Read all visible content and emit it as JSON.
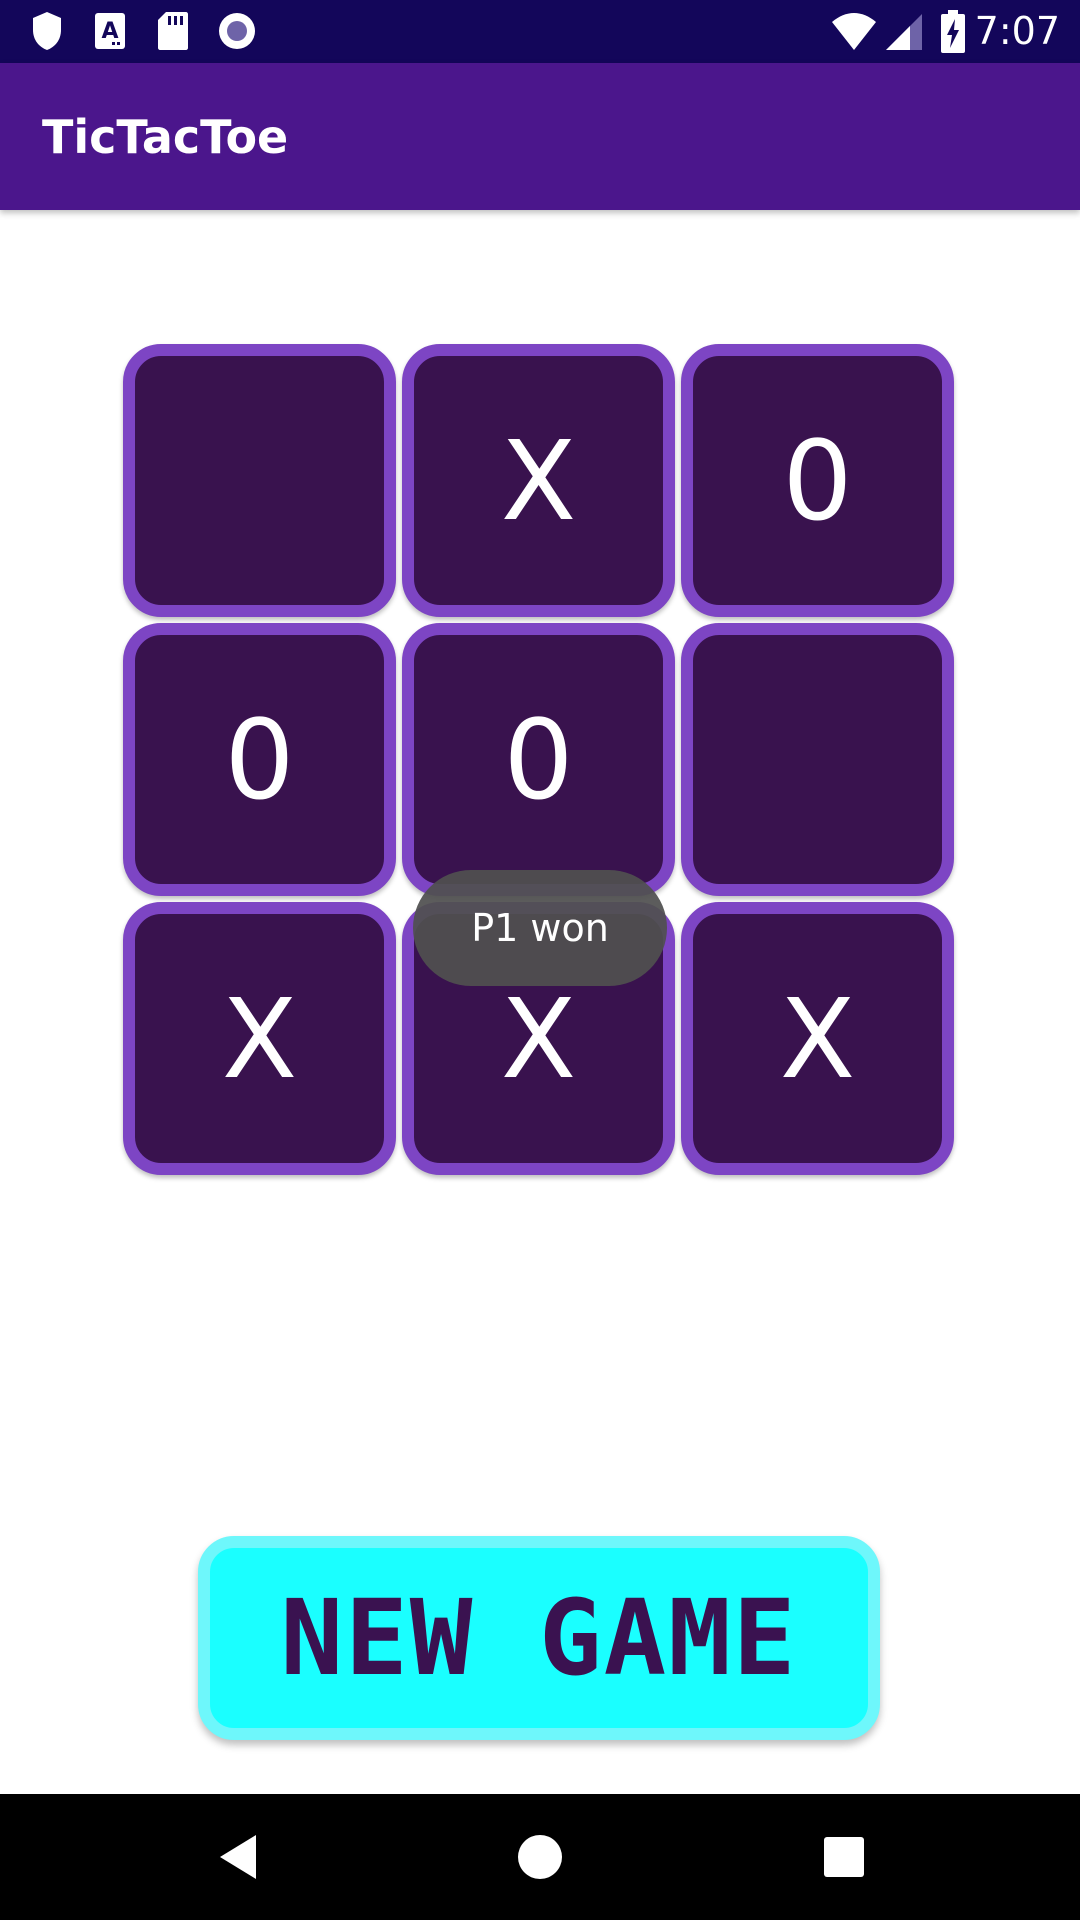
{
  "status_bar": {
    "time": "7:07",
    "left_icons": [
      "shield-icon",
      "text-a-icon",
      "sd-card-icon",
      "record-icon"
    ],
    "right_icons": [
      "wifi-icon",
      "signal-icon",
      "battery-charging-icon"
    ]
  },
  "app_bar": {
    "title": "TicTacToe"
  },
  "board": {
    "cells": [
      "",
      "X",
      "0",
      "0",
      "0",
      "",
      "X",
      "X",
      "X"
    ]
  },
  "toast": {
    "message": "P1 won"
  },
  "new_game_button": {
    "label": "NEW GAME"
  },
  "nav_bar": {
    "buttons": [
      "back-icon",
      "home-icon",
      "recents-icon"
    ]
  },
  "colors": {
    "status_bar": "#13065a",
    "app_bar": "#4b168c",
    "cell_fill": "#39124e",
    "cell_border": "#7d45c4",
    "button_fill": "#1affff",
    "button_text": "#3a1250"
  }
}
